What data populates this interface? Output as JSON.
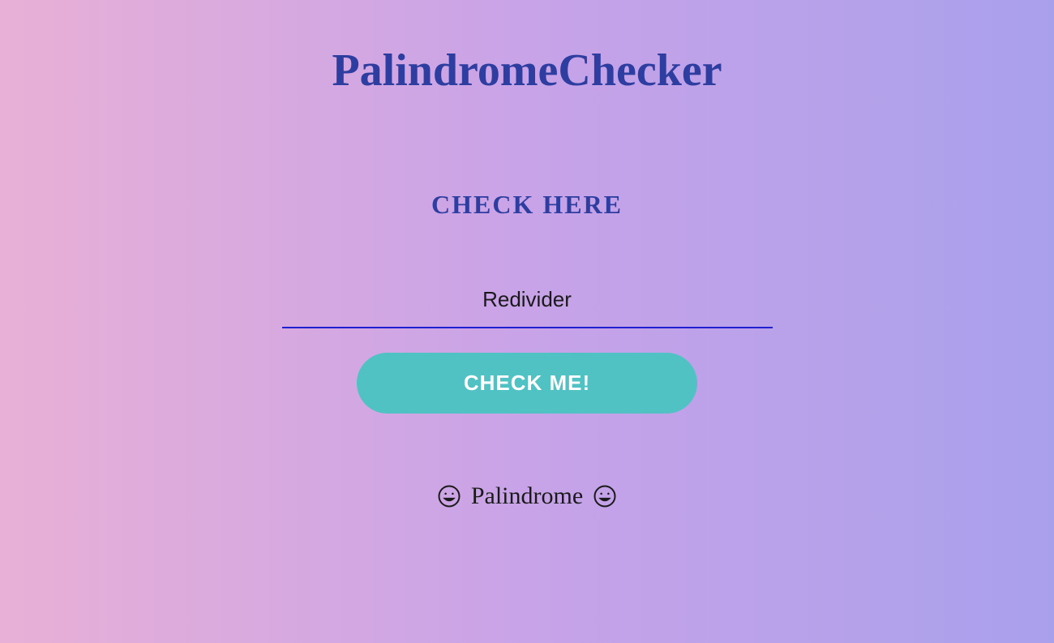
{
  "title": "PalindromeChecker",
  "subtitle": "CHECK HERE",
  "input": {
    "value": "Redivider"
  },
  "button": {
    "label": "CHECK ME!"
  },
  "result": {
    "text": "Palindrome"
  }
}
